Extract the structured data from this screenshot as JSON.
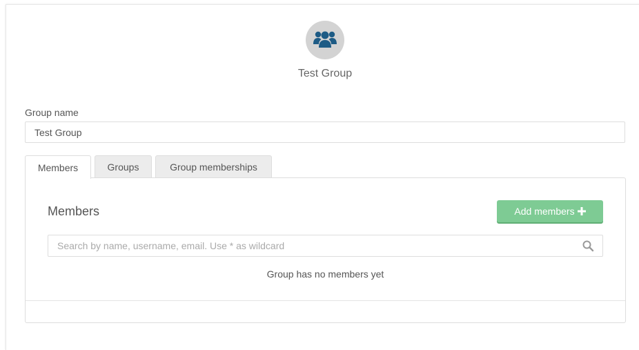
{
  "group": {
    "title": "Test Group",
    "avatar_icon": "users-group-icon"
  },
  "form": {
    "group_name_label": "Group name",
    "group_name_value": "Test Group"
  },
  "tabs": [
    {
      "label": "Members",
      "active": true
    },
    {
      "label": "Groups",
      "active": false
    },
    {
      "label": "Group memberships",
      "active": false
    }
  ],
  "members": {
    "heading": "Members",
    "add_button_label": "Add members",
    "search_placeholder": "Search by name, username, email. Use * as wildcard",
    "empty_message": "Group has no members yet"
  },
  "colors": {
    "avatar_icon": "#1d5b85",
    "add_button": "#7ecb94"
  }
}
